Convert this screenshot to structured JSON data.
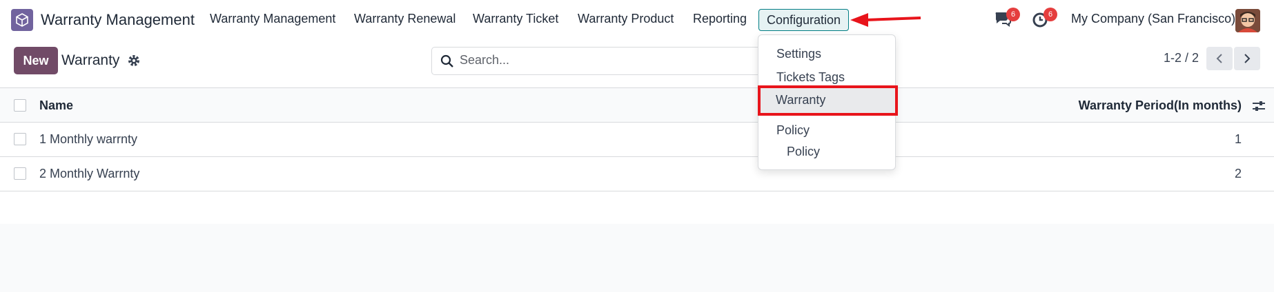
{
  "navbar": {
    "app_name": "Warranty Management",
    "menu": [
      "Warranty Management",
      "Warranty Renewal",
      "Warranty Ticket",
      "Warranty Product",
      "Reporting",
      "Configuration"
    ],
    "messages_badge": "6",
    "activities_badge": "6",
    "company": "My Company (San Francisco)",
    "accent_color": "#714b67"
  },
  "control": {
    "new_label": "New",
    "breadcrumb": "Warranty",
    "search_placeholder": "Search...",
    "pager": "1-2 / 2"
  },
  "table": {
    "columns": [
      "Name",
      "Warranty Period(In months)"
    ],
    "rows": [
      {
        "name": "1 Monthly warrnty",
        "period": "1"
      },
      {
        "name": "2 Monthly Warrnty",
        "period": "2"
      }
    ]
  },
  "dropdown": {
    "items": [
      "Settings",
      "Tickets Tags",
      "Warranty"
    ],
    "section_header": "Policy",
    "section_items": [
      "Policy"
    ],
    "highlighted": "Warranty",
    "highlight_color": "#e8141b"
  }
}
